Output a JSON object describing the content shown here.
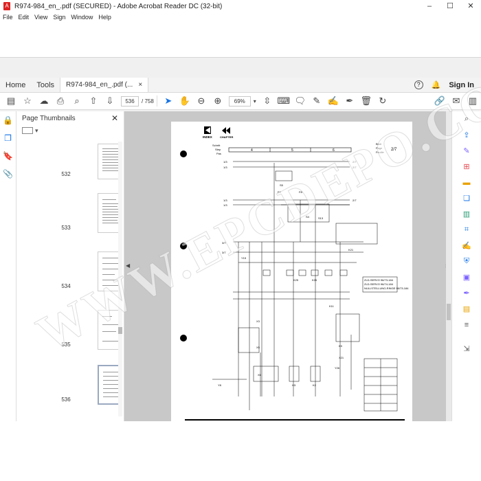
{
  "window": {
    "title": "R974-984_en_.pdf (SECURED) - Adobe Acrobat Reader DC (32-bit)",
    "minimize": "–",
    "maximize": "☐",
    "close": "✕"
  },
  "menu": [
    "File",
    "Edit",
    "View",
    "Sign",
    "Window",
    "Help"
  ],
  "tabs": {
    "home": "Home",
    "tools": "Tools",
    "doc": "R974-984_en_.pdf (...",
    "doc_close": "×",
    "signin": "Sign In"
  },
  "toolbar": {
    "page_current": "536",
    "page_total": "/ 758",
    "zoom": "69%"
  },
  "thumbs": {
    "title": "Page Thumbnails",
    "items": [
      "532",
      "533",
      "534",
      "535",
      "536"
    ]
  },
  "diagram": {
    "index": "INDEX",
    "chapter": "CHAPTER",
    "header_rows": [
      "Schritt",
      "Step",
      "Pas"
    ],
    "header_cols": [
      "4",
      "5",
      "6"
    ],
    "blatt": [
      "Blatt",
      "Page",
      "Feuille"
    ],
    "page_no": "2/7",
    "refs": [
      "1/3",
      "1/3",
      "1/3",
      "1/3",
      "2/7",
      "2/7",
      "2/7",
      "3/7",
      "3/7"
    ],
    "labels": [
      "S5",
      "F2",
      "F8",
      "S4",
      "S13",
      "Y15",
      "K21",
      "K25",
      "K26",
      "X3",
      "X5",
      "X6",
      "Y8",
      "H3",
      "K2",
      "K9",
      "K11",
      "Y26",
      "X21"
    ],
    "notes": [
      "ZLD-SERVO 96/73-184",
      "ZLD-SERVO 96/74-184",
      "NULLSTELLUNG-RINGE 96/73-184"
    ]
  },
  "watermark": "WWW.EPCDEPO.COM",
  "colors": {
    "accent": "#1473e6",
    "pdf_red": "#d22222",
    "doc_bg": "#c8c8c8"
  }
}
